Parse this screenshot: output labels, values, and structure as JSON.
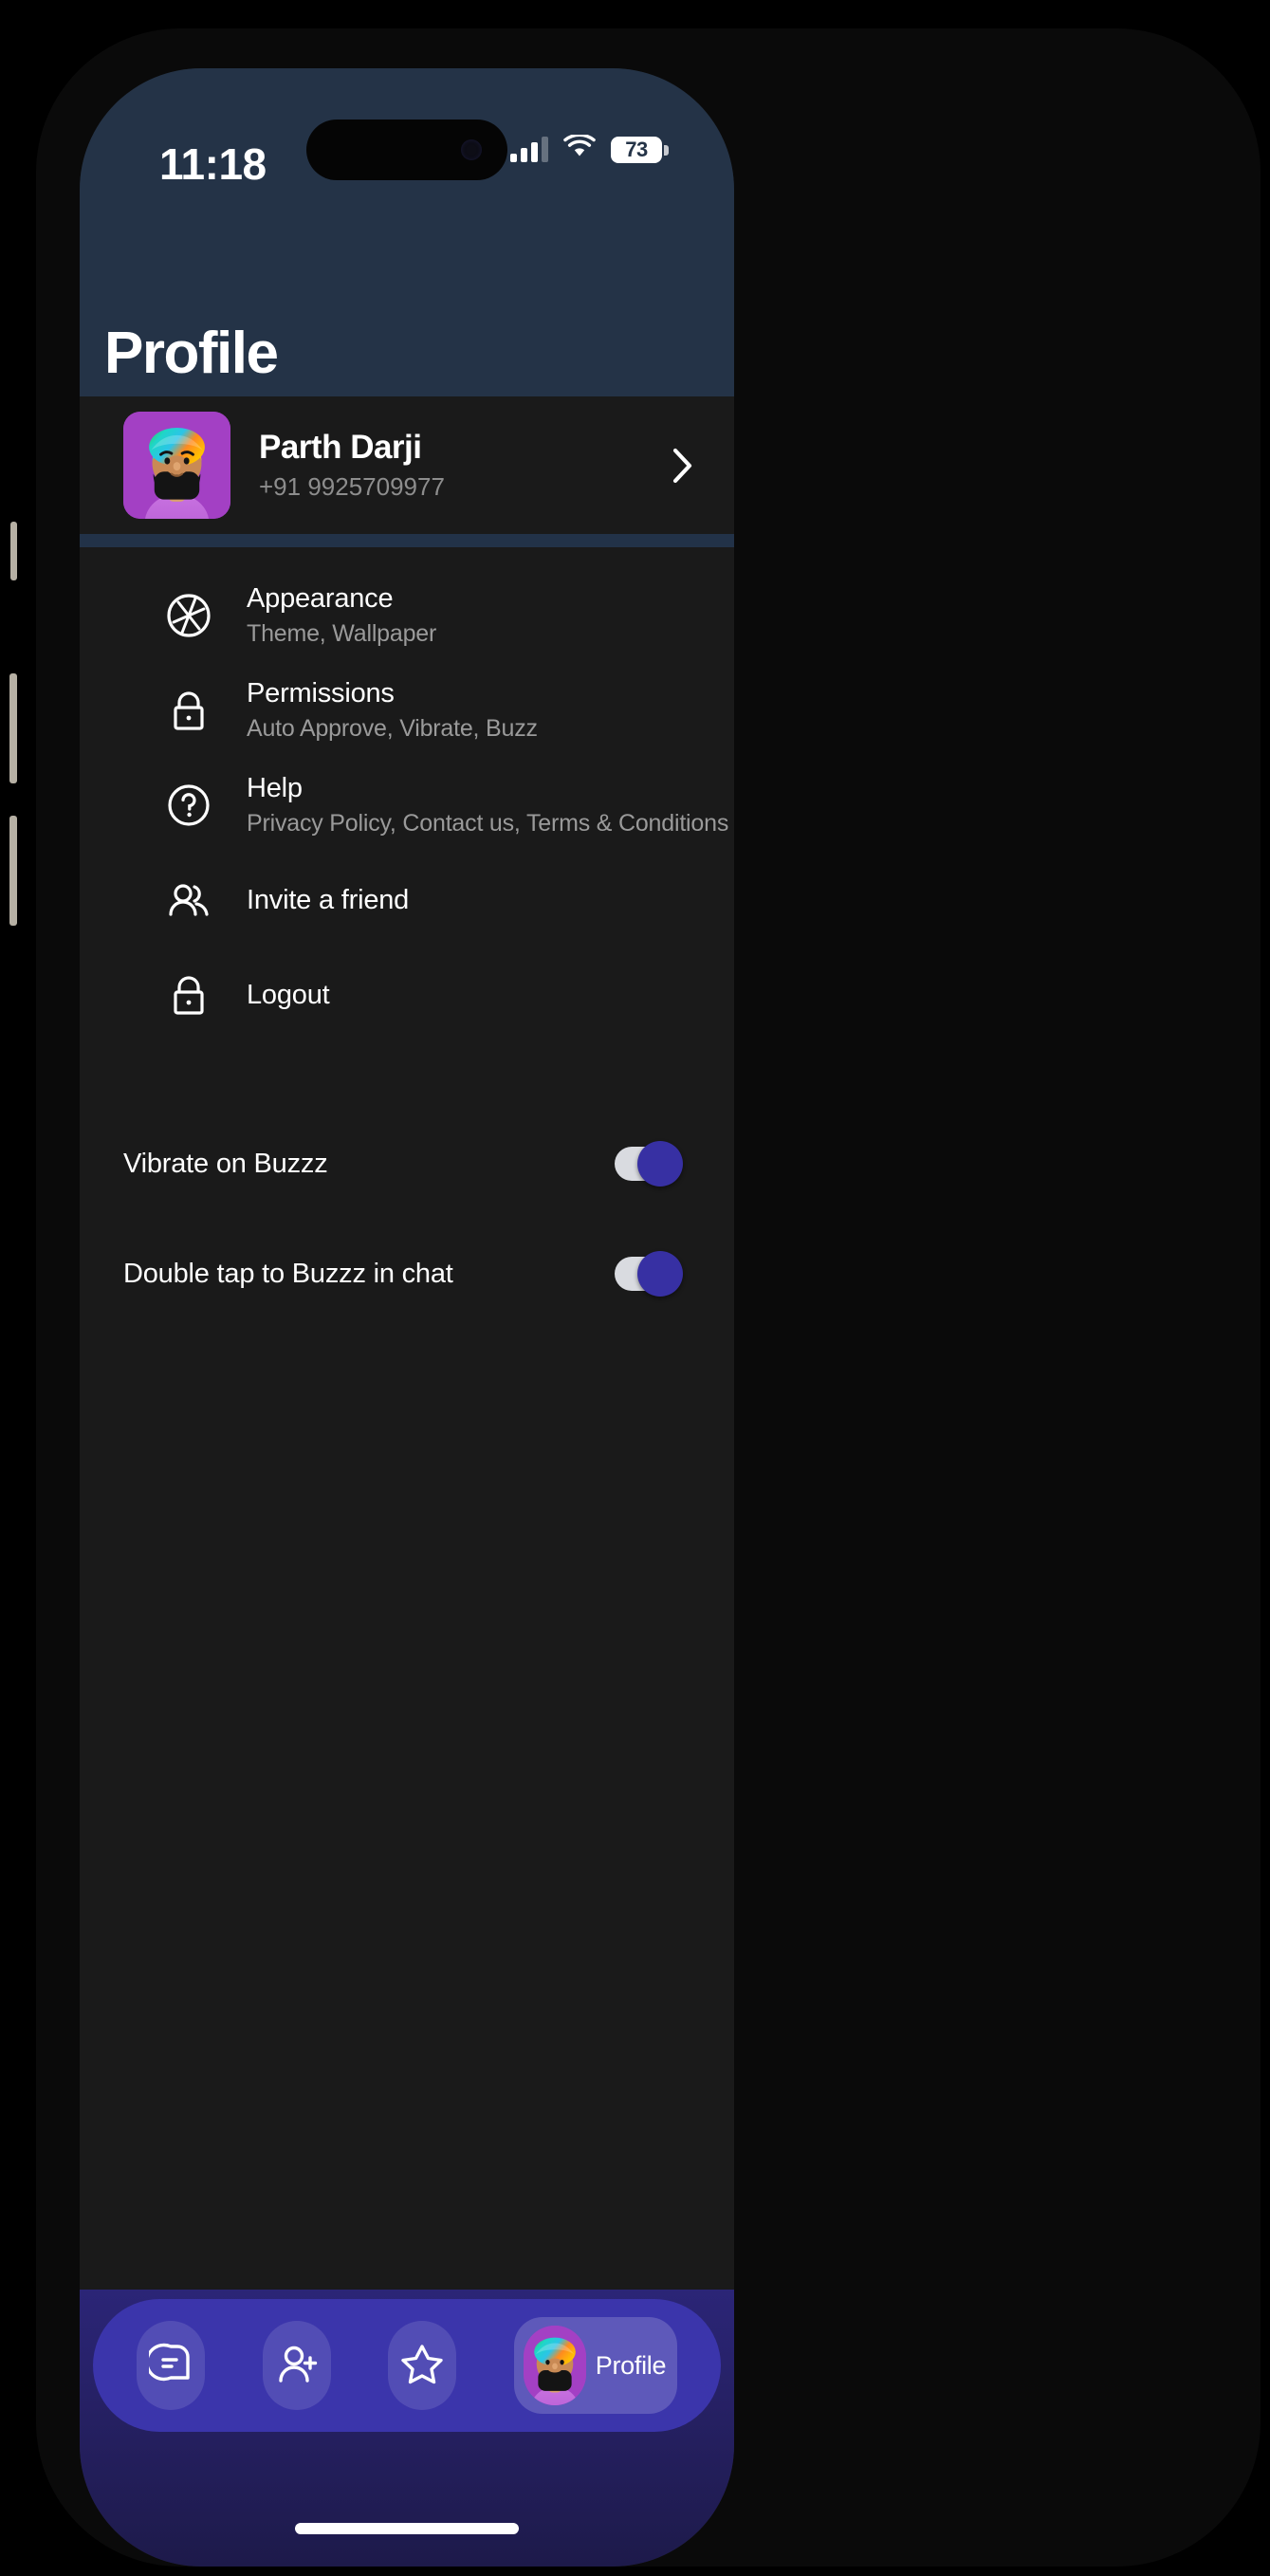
{
  "status_bar": {
    "time": "11:18",
    "battery_level": "73",
    "signal_icon": "cellular-signal-icon",
    "wifi_icon": "wifi-icon",
    "battery_icon": "battery-icon"
  },
  "header": {
    "title": "Profile"
  },
  "profile_card": {
    "name": "Parth Darji",
    "phone": "+91 9925709977",
    "avatar_icon": "user-avatar",
    "chevron_icon": "chevron-right-icon"
  },
  "menu": {
    "items": [
      {
        "icon": "aperture-icon",
        "title": "Appearance",
        "subtitle": "Theme, Wallpaper"
      },
      {
        "icon": "lock-icon",
        "title": "Permissions",
        "subtitle": "Auto Approve, Vibrate, Buzz"
      },
      {
        "icon": "help-circle-icon",
        "title": "Help",
        "subtitle": "Privacy Policy, Contact us, Terms & Conditions"
      },
      {
        "icon": "people-icon",
        "title": "Invite a friend",
        "subtitle": ""
      },
      {
        "icon": "lock-icon",
        "title": "Logout",
        "subtitle": ""
      }
    ]
  },
  "toggles": [
    {
      "label": "Vibrate on Buzzz",
      "state": "on"
    },
    {
      "label": "Double tap to Buzzz in chat",
      "state": "on"
    }
  ],
  "bottom_nav": {
    "items": [
      {
        "icon": "chat-bubble-icon",
        "label": "",
        "active": false
      },
      {
        "icon": "add-person-icon",
        "label": "",
        "active": false
      },
      {
        "icon": "star-icon",
        "label": "",
        "active": false
      },
      {
        "icon": "user-avatar",
        "label": "Profile",
        "active": true
      }
    ]
  },
  "colors": {
    "header_bg": "#243347",
    "content_bg": "#1a1a1a",
    "nav_bg": "#3b35ab",
    "accent": "#3730a3",
    "avatar_bg": "#a340c4",
    "subtitle_text": "#9a9a9a"
  }
}
